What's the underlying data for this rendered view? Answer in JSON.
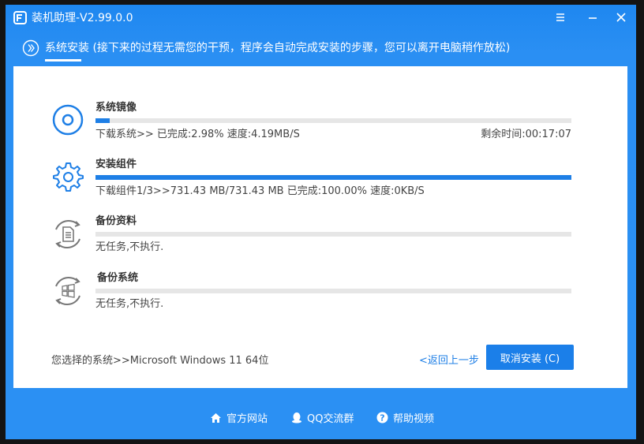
{
  "window": {
    "title": "装机助理-V2.99.0.0",
    "accent": "#1e7fe6"
  },
  "step": {
    "title": "系统安装 (接下来的过程无需您的干预，程序会自动完成安装的步骤，您可以离开电脑稍作放松)"
  },
  "tasks": [
    {
      "name": "系统镜像",
      "icon": "disc-icon",
      "progress": 0.0298,
      "status": "下载系统>>  已完成:2.98%  速度:4.19MB/S",
      "remaining": "剩余时间:00:17:07"
    },
    {
      "name": "安装组件",
      "icon": "gear-icon",
      "progress": 1.0,
      "status": "下载组件1/3>>731.43 MB/731.43 MB 已完成:100.00%  速度:0KB/S",
      "remaining": ""
    },
    {
      "name": "备份资料",
      "icon": "document-icon",
      "progress": 0,
      "status": "无任务,不执行.",
      "remaining": ""
    },
    {
      "name": "备份系统",
      "icon": "windows-icon",
      "progress": 0,
      "status": "无任务,不执行.",
      "remaining": ""
    }
  ],
  "bottom": {
    "selected_os": "您选择的系统>>Microsoft Windows 11 64位",
    "back_label": "<返回上一步",
    "cancel_label": "取消安装 (C)"
  },
  "footer": {
    "links": [
      {
        "label": "官方网站",
        "icon": "home-icon"
      },
      {
        "label": "QQ交流群",
        "icon": "qq-icon"
      },
      {
        "label": "帮助视频",
        "icon": "help-icon"
      }
    ]
  }
}
